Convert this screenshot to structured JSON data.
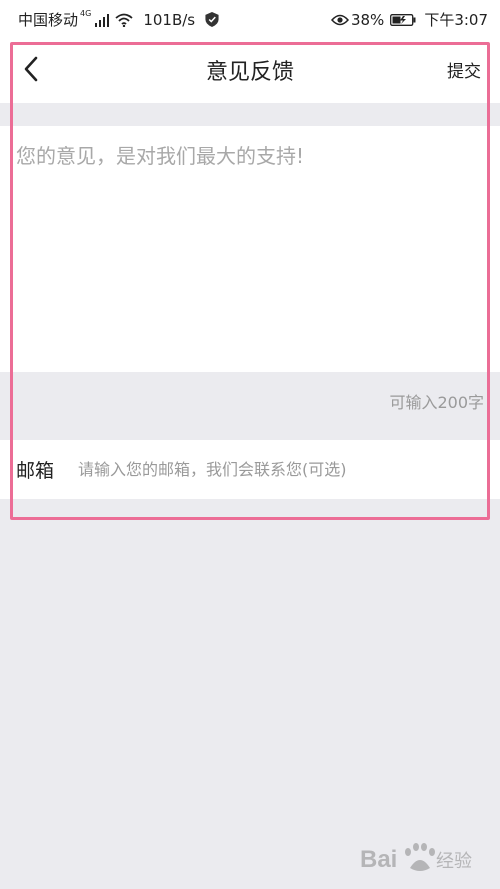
{
  "status_bar": {
    "carrier": "中国移动",
    "network_type": "4G",
    "speed": "101B/s",
    "battery": "38%",
    "time": "下午3:07"
  },
  "nav": {
    "title": "意见反馈",
    "submit_label": "提交"
  },
  "feedback": {
    "placeholder": "您的意见，是对我们最大的支持!",
    "value": "",
    "char_limit_text": "可输入200字"
  },
  "email": {
    "label": "邮箱",
    "placeholder": "请输入您的邮箱，我们会联系您(可选)",
    "value": ""
  },
  "annotation": {
    "highlight_color": "#ec6d96"
  },
  "watermark": {
    "text": "Bai经验"
  }
}
